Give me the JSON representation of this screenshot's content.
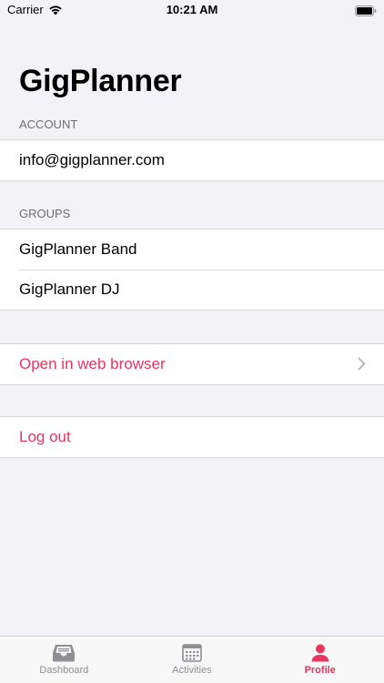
{
  "status_bar": {
    "carrier": "Carrier",
    "time": "10:21 AM"
  },
  "app_title": "GigPlanner",
  "account": {
    "header": "ACCOUNT",
    "email": "info@gigplanner.com"
  },
  "groups": {
    "header": "GROUPS",
    "items": [
      "GigPlanner Band",
      "GigPlanner DJ"
    ]
  },
  "actions": {
    "open_browser": "Open in web browser",
    "log_out": "Log out"
  },
  "tab_bar": {
    "tabs": [
      {
        "label": "Dashboard",
        "icon": "inbox-tray-icon",
        "active": false
      },
      {
        "label": "Activities",
        "icon": "calendar-icon",
        "active": false
      },
      {
        "label": "Profile",
        "icon": "person-icon",
        "active": true
      }
    ]
  },
  "colors": {
    "accent": "#e8345f",
    "background": "#f2f2f7",
    "secondary_text": "#6d6d72"
  }
}
